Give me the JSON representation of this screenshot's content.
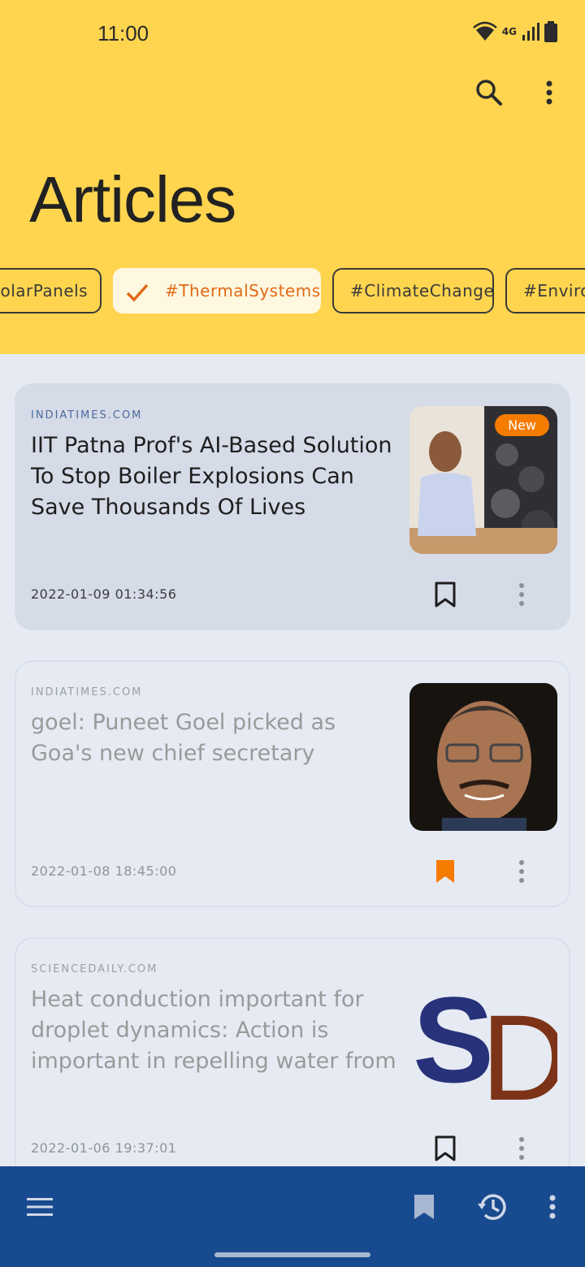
{
  "status": {
    "time": "11:00",
    "network": "4G"
  },
  "header": {
    "title": "Articles"
  },
  "chips": [
    {
      "label": "#SolarPanels",
      "selected": false
    },
    {
      "label": "#ThermalSystems",
      "selected": true
    },
    {
      "label": "#ClimateChange",
      "selected": false
    },
    {
      "label": "#Environment",
      "selected": false
    }
  ],
  "articles": [
    {
      "source": "INDIATIMES.COM",
      "headline": "IIT Patna Prof's AI-Based Solution To Stop Boiler Explosions Can Save Thousands Of Lives",
      "date": "2022-01-09 01:34:56",
      "badge": "New",
      "bookmarked": false
    },
    {
      "source": "INDIATIMES.COM",
      "headline": "goel: Puneet Goel picked as Goa's new chief secretary",
      "date": "2022-01-08 18:45:00",
      "bookmarked": true
    },
    {
      "source": "SCIENCEDAILY.COM",
      "headline": "Heat conduction important for droplet dynamics: Action is important in repelling water from",
      "date": "2022-01-06 19:37:01",
      "logo_letters": "SD",
      "bookmarked": false
    }
  ],
  "colors": {
    "header": "#ffd54f",
    "accent": "#f57c00",
    "bottombar": "#184a8f"
  }
}
